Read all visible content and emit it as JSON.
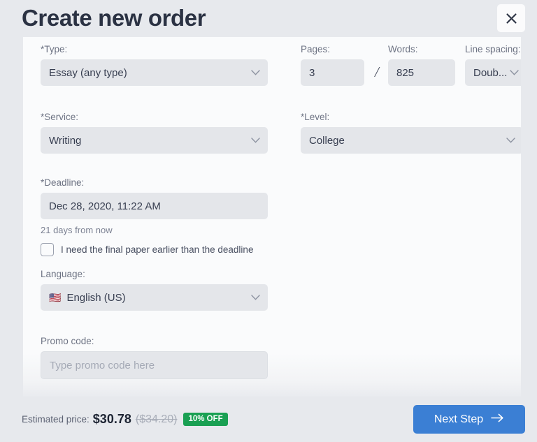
{
  "header": {
    "title": "Create new order",
    "close_icon": "close-icon"
  },
  "form": {
    "type": {
      "label": "*Type:",
      "value": "Essay (any type)",
      "chevron_icon": "chevron-down-icon"
    },
    "pages": {
      "label": "Pages:",
      "value": "3"
    },
    "separator": "/",
    "words": {
      "label": "Words:",
      "value": "825"
    },
    "line_spacing": {
      "label": "Line spacing:",
      "value": "Doub...",
      "chevron_icon": "chevron-down-icon"
    },
    "service": {
      "label": "*Service:",
      "value": "Writing",
      "chevron_icon": "chevron-down-icon"
    },
    "level": {
      "label": "*Level:",
      "value": "College",
      "chevron_icon": "chevron-down-icon"
    },
    "deadline": {
      "label": "*Deadline:",
      "value": "Dec 28, 2020, 11:22 AM",
      "hint": "21 days from now",
      "earlier_checkbox_label": "I need the final paper earlier than the deadline",
      "earlier_checkbox_checked": false
    },
    "language": {
      "label": "Language:",
      "value": "English (US)",
      "flag_icon": "us-flag-icon",
      "flag_glyph": "🇺🇸",
      "chevron_icon": "chevron-down-icon"
    },
    "promo": {
      "label": "Promo code:",
      "value": "",
      "placeholder": "Type promo code here"
    }
  },
  "footer": {
    "price_caption": "Estimated price:",
    "price_current": "$30.78",
    "price_original": "($34.20)",
    "discount_badge": "10% OFF",
    "next_step_label": "Next Step",
    "next_step_icon": "arrow-right-icon"
  },
  "colors": {
    "page_background": "#e7e9ed",
    "panel_background": "#fafbfc",
    "control_background": "#e4e6ea",
    "text_primary": "#2e3546",
    "text_muted": "#6d7383",
    "accent_blue": "#3b7fd4",
    "discount_green": "#1aa053"
  }
}
